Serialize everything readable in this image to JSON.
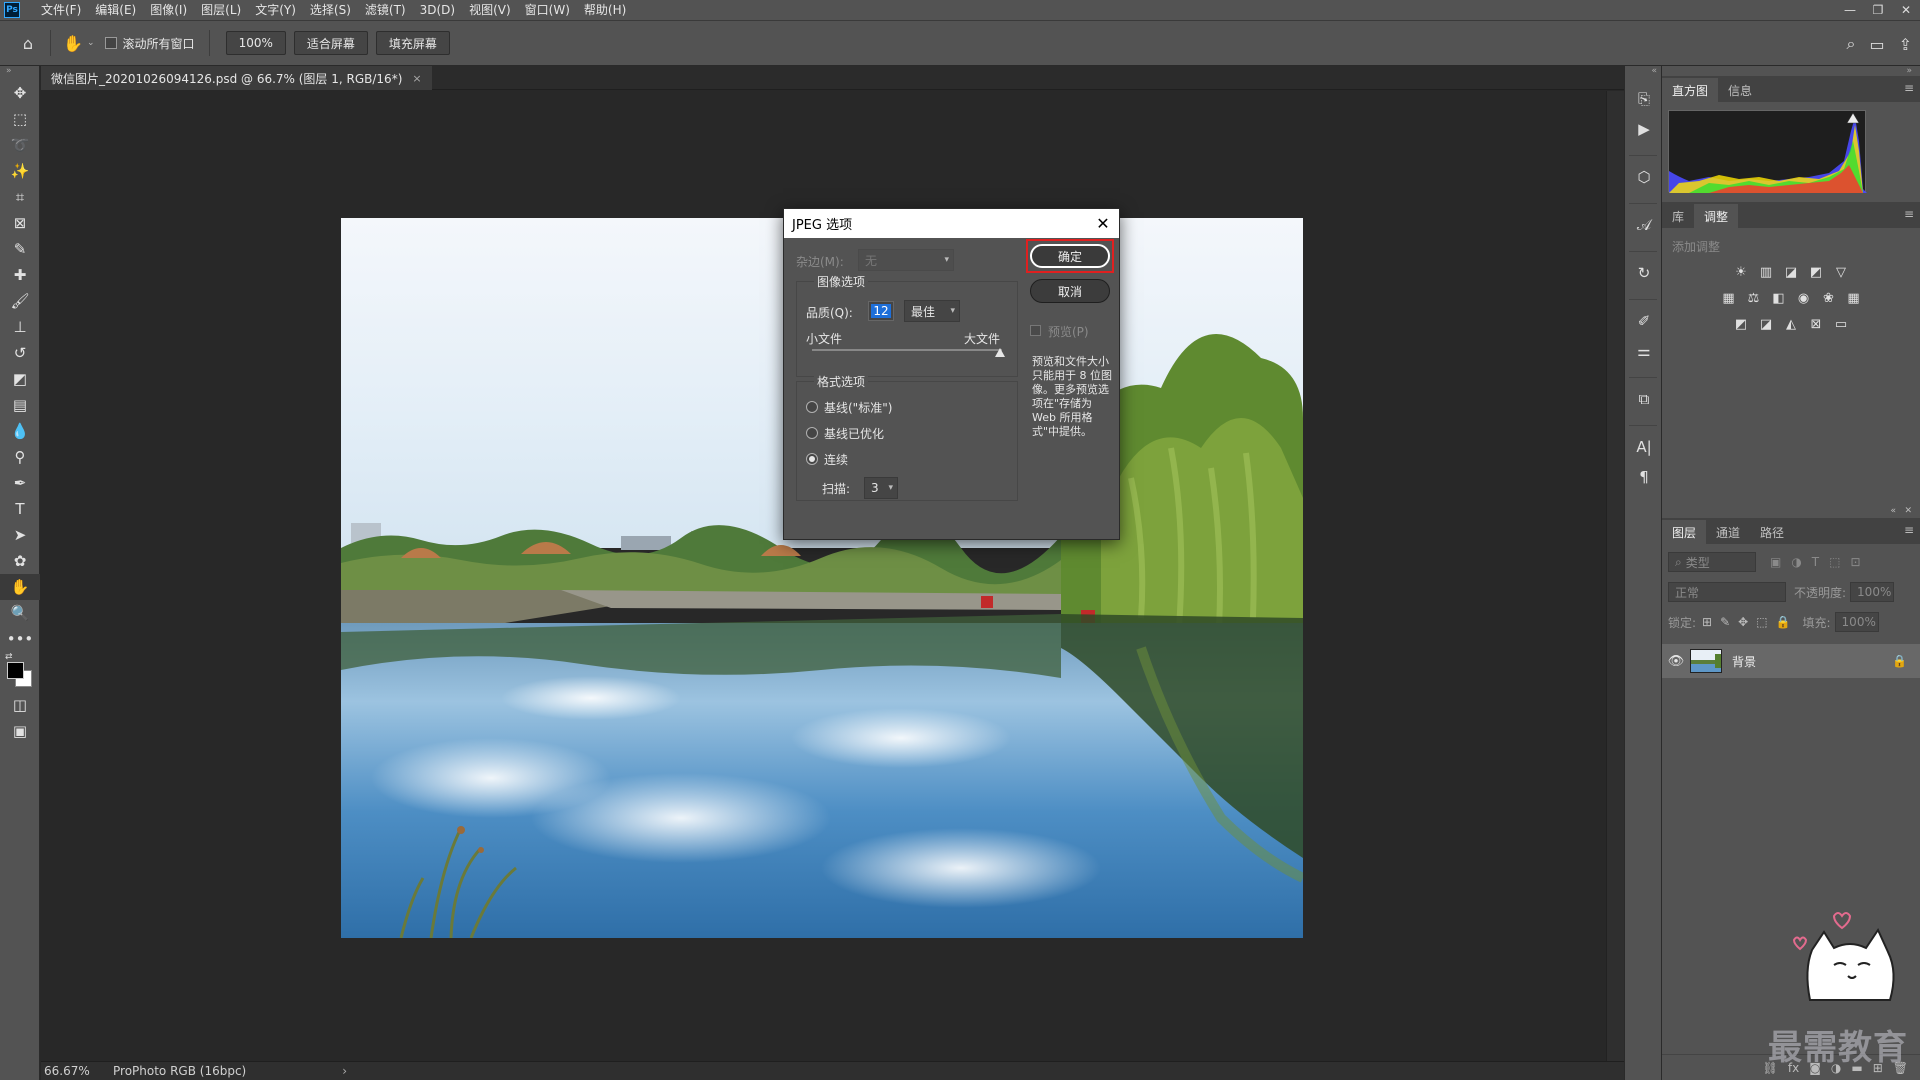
{
  "menubar": {
    "logo": "Ps",
    "items": [
      "文件(F)",
      "编辑(E)",
      "图像(I)",
      "图层(L)",
      "文字(Y)",
      "选择(S)",
      "滤镜(T)",
      "3D(D)",
      "视图(V)",
      "窗口(W)",
      "帮助(H)"
    ],
    "window_controls": [
      "—",
      "❐",
      "✕"
    ]
  },
  "optionsbar": {
    "scroll_all_label": "滚动所有窗口",
    "zoom_button": "100%",
    "fit_screen_button": "适合屏幕",
    "fill_screen_button": "填充屏幕"
  },
  "document": {
    "tab_title": "微信图片_20201026094126.psd @ 66.7% (图层 1, RGB/16*)",
    "close_glyph": "×"
  },
  "statusbar": {
    "zoom": "66.67%",
    "profile": "ProPhoto RGB (16bpc)",
    "arrow": "›"
  },
  "histogram_panel": {
    "tabs": [
      "直方图",
      "信息"
    ],
    "active_tab": "直方图"
  },
  "adjustments_panel": {
    "tabs": [
      "库",
      "调整"
    ],
    "active_tab": "调整",
    "title": "添加调整"
  },
  "layers_panel": {
    "tabs": [
      "图层",
      "通道",
      "路径"
    ],
    "active_tab": "图层",
    "filter_placeholder": "类型",
    "blend_mode": "正常",
    "opacity_label": "不透明度:",
    "opacity_value": "100%",
    "lock_label": "锁定:",
    "fill_label": "填充:",
    "fill_value": "100%",
    "layer_name": "背景"
  },
  "watermark": {
    "text": "最需教育"
  },
  "dialog": {
    "title": "JPEG 选项",
    "matte_label": "杂边(M):",
    "matte_value": "无",
    "image_options_title": "图像选项",
    "quality_label": "品质(Q):",
    "quality_value": "12",
    "quality_preset": "最佳",
    "small_file": "小文件",
    "large_file": "大文件",
    "quality_fraction": 1.0,
    "format_options_title": "格式选项",
    "format_baseline": "基线(\"标准\")",
    "format_optimized": "基线已优化",
    "format_progressive": "连续",
    "format_selected": "连续",
    "scans_label": "扫描:",
    "scans_value": "3",
    "ok_button": "确定",
    "cancel_button": "取消",
    "preview_label": "预览(P)",
    "note": "预览和文件大小只能用于 8 位图像。更多预览选项在\"存储为 Web 所用格式\"中提供。"
  },
  "colors": {
    "highlight_red": "#e02020",
    "selection_blue": "#1e6fd9"
  }
}
